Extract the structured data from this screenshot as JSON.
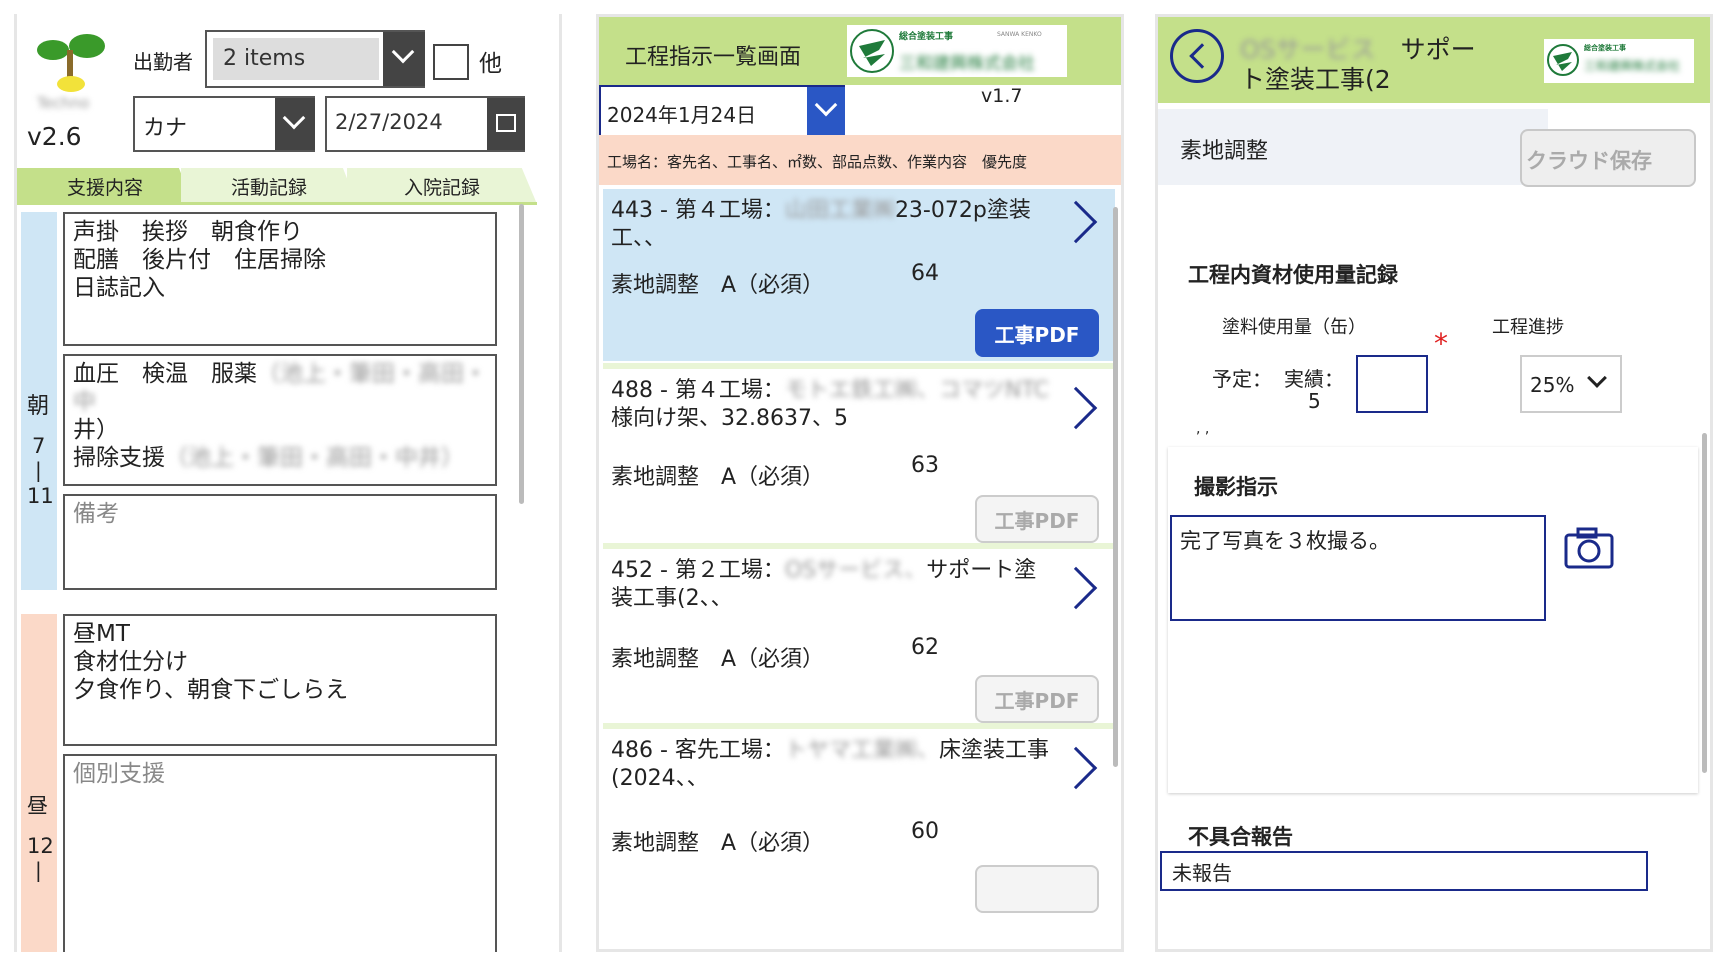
{
  "panel1": {
    "version": "v2.6",
    "logo_text": "Techno",
    "attendee_label": "出勤者",
    "attendee_value": "2 items",
    "other_label": "他",
    "kana_value": "カナ",
    "date_value": "2/27/2024",
    "tabs": [
      {
        "label": "支援内容"
      },
      {
        "label": "活動記録"
      },
      {
        "label": "入院記録"
      }
    ],
    "morning": {
      "label_char": "朝",
      "time_start": "7",
      "time_sep": "|",
      "time_end": "11",
      "box1_lines": [
        "声掛　挨拶　朝食作り",
        "配膳　後片付　住居掃除",
        "日誌記入"
      ],
      "box2_line1": "血圧　検温　服薬",
      "box2_line1_blur": "（池上・筆田・高田・中",
      "box2_line2": "井）",
      "box2_line3": "掃除支援",
      "box2_line3_blur": "（池上・筆田・高田・中井）",
      "notes_placeholder": "備考"
    },
    "noon": {
      "label_char": "昼",
      "time_start": "12",
      "box1_lines": [
        "昼MT",
        "食材仕分け",
        "夕食作り、朝食下ごしらえ"
      ],
      "individual_placeholder": "個別支援"
    }
  },
  "panel2": {
    "title": "工程指示一覧画面",
    "company_small": "総合塗装工事",
    "company_en": "SANWA KENKO",
    "company_name": "三和建興株式会社",
    "version": "v1.7",
    "date_value": "2024年1月24日",
    "columns_header": "工場名：客先名、工事名、㎡数、部品点数、作業内容　優先度",
    "items": [
      {
        "prefix": "443 - 第４工場：",
        "blur": "山田工業㈱",
        "suffix": "23-072p塗装工、、",
        "task": "素地調整　A（必須）",
        "priority": "64",
        "pdf_label": "工事PDF"
      },
      {
        "prefix": "488 - 第４工場：",
        "blur": "モトエ鉄工㈱、コマツNTC",
        "suffix": "様向け架、32.8637、5",
        "task": "素地調整　A（必須）",
        "priority": "63",
        "pdf_label": "工事PDF"
      },
      {
        "prefix": "452 - 第２工場：",
        "blur": "OSサービス、",
        "suffix": "サポート塗装工事(2、、",
        "task": "素地調整　A（必須）",
        "priority": "62",
        "pdf_label": "工事PDF"
      },
      {
        "prefix": "486 - 客先工場：",
        "blur": "トヤマ工業㈱、",
        "suffix": "床塗装工事(2024、、",
        "task": "素地調整　A（必須）",
        "priority": "60"
      }
    ]
  },
  "panel3": {
    "title_blur": "OSサービス",
    "title_line1": "サポー",
    "title_line2": "ト塗装工事(2",
    "company_small": "総合塗装工事",
    "company_name": "三和建興株式会社",
    "task_label": "素地調整",
    "cloud_save": "クラウド保存",
    "section_title": "工程内資材使用量記録",
    "paint_label": "塗料使用量（缶）",
    "required_mark": "*",
    "progress_label": "工程進捗",
    "plan_label": "予定：",
    "actual_label": "実績：",
    "plan_value": "5",
    "progress_value": "25%",
    "stray_text": ", ,",
    "photo_title": "撮影指示",
    "photo_text": "完了写真を３枚撮る。",
    "defect_title": "不具合報告",
    "defect_partial": "未報告"
  },
  "colors": {
    "green": "#c4e08a",
    "tab_green": "#e9f5d6",
    "blue_side": "#cfe6f5",
    "peach_side": "#fbd9c8",
    "selected_card": "#cfe6f5",
    "navy": "#1a2a8a"
  }
}
